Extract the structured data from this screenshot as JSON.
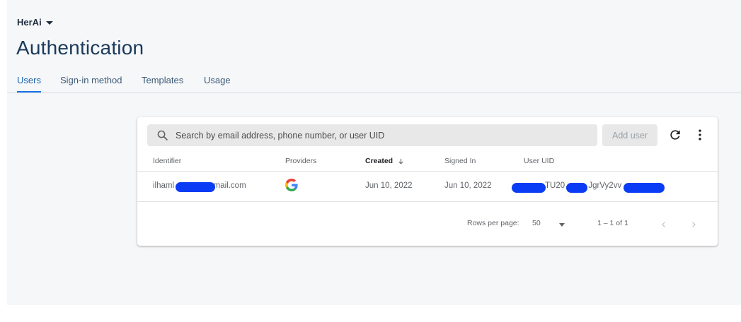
{
  "project": {
    "name": "HerAi"
  },
  "page": {
    "title": "Authentication"
  },
  "tabs": [
    {
      "label": "Users"
    },
    {
      "label": "Sign-in method"
    },
    {
      "label": "Templates"
    },
    {
      "label": "Usage"
    }
  ],
  "toolbar": {
    "search_placeholder": "Search by email address, phone number, or user UID",
    "add_user_label": "Add user",
    "refresh_icon": "refresh-icon",
    "more_icon": "more-vert-icon"
  },
  "table": {
    "columns": [
      "Identifier",
      "Providers",
      "Created",
      "Signed In",
      "User UID"
    ],
    "rows": [
      {
        "identifier_prefix": "ilhaml",
        "identifier_suffix": "gmail.com",
        "provider_icon": "google-icon",
        "created": "Jun 10, 2022",
        "signed_in": "Jun 10, 2022",
        "uid_part1": "TU20",
        "uid_part2": "JgrVy2vv"
      }
    ]
  },
  "footer": {
    "rows_per_page_label": "Rows per page:",
    "rows_per_page_value": "50",
    "range": "1 – 1 of 1"
  },
  "colors": {
    "accent": "#1a73e8",
    "redaction": "#0a3cf5"
  }
}
